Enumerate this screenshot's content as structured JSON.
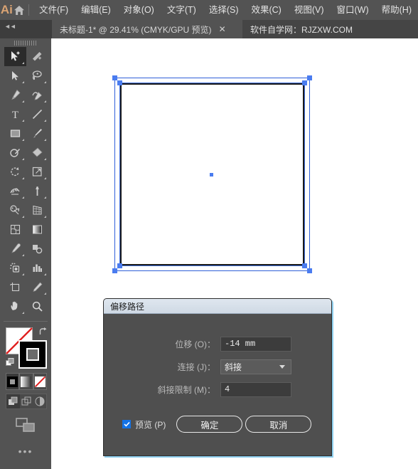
{
  "app": {
    "logo": "Ai",
    "home_icon": "home-icon"
  },
  "menubar": {
    "items": [
      {
        "label": "文件(F)"
      },
      {
        "label": "编辑(E)"
      },
      {
        "label": "对象(O)"
      },
      {
        "label": "文字(T)"
      },
      {
        "label": "选择(S)"
      },
      {
        "label": "效果(C)"
      },
      {
        "label": "视图(V)"
      },
      {
        "label": "窗口(W)"
      },
      {
        "label": "帮助(H)"
      }
    ]
  },
  "tabbar": {
    "collapse_glyph": "◄◄",
    "tabs": [
      {
        "title": "未标题-1* @ 29.41% (CMYK/GPU 预览)",
        "close": "✕",
        "active": true
      },
      {
        "title": "软件自学网：RJZXW.COM",
        "active": false
      }
    ]
  },
  "toolbar": {
    "tools": [
      {
        "name": "selection-plus-tool",
        "selected": true
      },
      {
        "name": "magic-wand-tool",
        "selected": false
      },
      {
        "name": "direct-selection-tool",
        "selected": false
      },
      {
        "name": "lasso-tool",
        "selected": false
      },
      {
        "name": "pen-tool",
        "selected": false
      },
      {
        "name": "curvature-tool",
        "selected": false
      },
      {
        "name": "type-tool",
        "selected": false
      },
      {
        "name": "line-segment-tool",
        "selected": false
      },
      {
        "name": "rectangle-tool",
        "selected": false
      },
      {
        "name": "paintbrush-tool",
        "selected": false
      },
      {
        "name": "shaper-tool",
        "selected": false
      },
      {
        "name": "eraser-tool",
        "selected": false
      },
      {
        "name": "rotate-tool",
        "selected": false
      },
      {
        "name": "scale-tool",
        "selected": false
      },
      {
        "name": "width-tool",
        "selected": false
      },
      {
        "name": "free-transform-tool",
        "selected": false
      },
      {
        "name": "shape-builder-tool",
        "selected": false
      },
      {
        "name": "perspective-grid-tool",
        "selected": false
      },
      {
        "name": "mesh-tool",
        "selected": false
      },
      {
        "name": "gradient-tool",
        "selected": false
      },
      {
        "name": "eyedropper-tool",
        "selected": false
      },
      {
        "name": "blend-tool",
        "selected": false
      },
      {
        "name": "symbol-sprayer-tool",
        "selected": false
      },
      {
        "name": "column-graph-tool",
        "selected": false
      },
      {
        "name": "artboard-tool",
        "selected": false
      },
      {
        "name": "slice-tool",
        "selected": false
      },
      {
        "name": "hand-tool",
        "selected": false
      },
      {
        "name": "zoom-tool",
        "selected": false
      }
    ],
    "fill_color": "#ffffff",
    "fill_is_none": true,
    "stroke_color": "#000000",
    "more_tools_glyph": "•••"
  },
  "canvas": {
    "zoom_label": "29.41%",
    "background": "#ffffff",
    "artwork": {
      "stroke_color": "#1b1b1b",
      "fill_color": "#ffffff",
      "selection_color": "#4a7cf0"
    }
  },
  "dialog": {
    "title": "偏移路径",
    "fields": [
      {
        "label": "位移 (O)：",
        "value": "-14 mm",
        "type": "text"
      },
      {
        "label": "连接 (J)：",
        "value": "斜接",
        "type": "select"
      },
      {
        "label": "斜接限制 (M)：",
        "value": "4",
        "type": "text"
      }
    ],
    "preview": {
      "label": "预览 (P)",
      "checked": true,
      "check_glyph": "✔"
    },
    "buttons": [
      {
        "label": "确定",
        "primary": true
      },
      {
        "label": "取消",
        "primary": false
      }
    ]
  }
}
